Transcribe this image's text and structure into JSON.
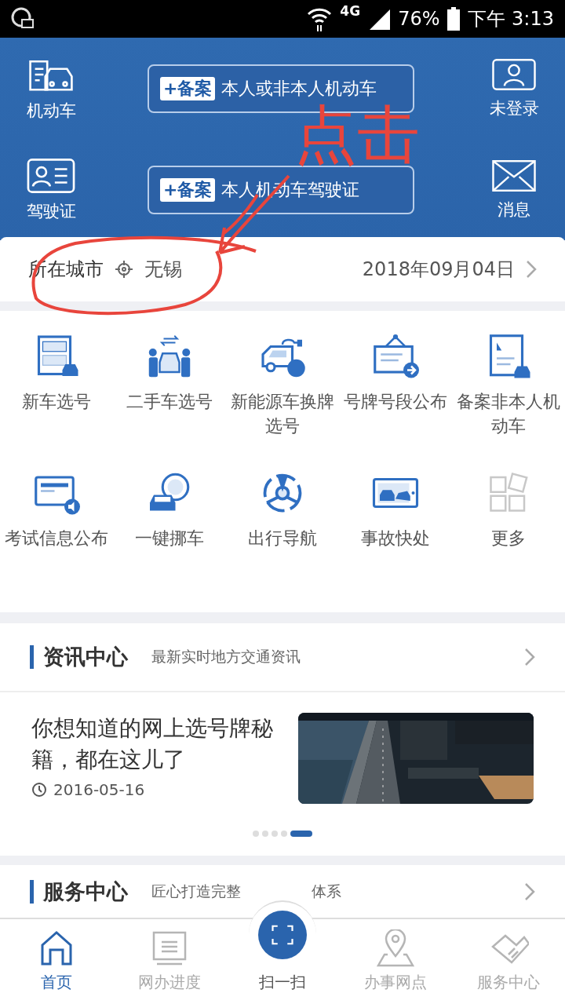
{
  "status_bar": {
    "network": "4G",
    "battery": "76%",
    "time": "下午 3:13"
  },
  "header": {
    "left": [
      {
        "kind": "car",
        "label": "机动车"
      },
      {
        "kind": "license",
        "label": "驾驶证"
      }
    ],
    "cards": [
      {
        "badge": "+备案",
        "text": "本人或非本人机动车"
      },
      {
        "badge": "+备案",
        "text": "本人机动车驾驶证"
      }
    ],
    "right": [
      {
        "kind": "user",
        "label": "未登录"
      },
      {
        "kind": "mail",
        "label": "消息"
      }
    ]
  },
  "city_bar": {
    "label": "所在城市",
    "city": "无锡",
    "date": "2018年09月04日"
  },
  "services": [
    {
      "kind": "plate",
      "label": "新车选号"
    },
    {
      "kind": "trade",
      "label": "二手车选号"
    },
    {
      "kind": "ev",
      "label": "新能源车换牌选号"
    },
    {
      "kind": "notice",
      "label": "号牌号段公布"
    },
    {
      "kind": "record",
      "label": "备案非本人机动车"
    },
    {
      "kind": "exam",
      "label": "考试信息公布"
    },
    {
      "kind": "move",
      "label": "一键挪车"
    },
    {
      "kind": "nav",
      "label": "出行导航"
    },
    {
      "kind": "accident",
      "label": "事故快处"
    },
    {
      "kind": "more",
      "label": "更多"
    }
  ],
  "news": {
    "title": "资讯中心",
    "subtitle": "最新实时地方交通资讯",
    "article": {
      "title": "你想知道的网上选号牌秘籍，都在这儿了",
      "date": "2016-05-16"
    },
    "dots": [
      {
        "selected": false
      },
      {
        "selected": false
      },
      {
        "selected": false
      },
      {
        "selected": false
      },
      {
        "selected": true
      }
    ]
  },
  "service_center": {
    "title": "服务中心",
    "subtitle_parts": [
      "匠心打造完整",
      "体系"
    ]
  },
  "tab_bar": [
    {
      "kind": "home",
      "label": "首页",
      "selected": true
    },
    {
      "kind": "progress",
      "label": "网办进度",
      "selected": false
    },
    {
      "kind": "scan",
      "label": "扫一扫",
      "selected": false
    },
    {
      "kind": "pin",
      "label": "办事网点",
      "selected": false
    },
    {
      "kind": "hands",
      "label": "服务中心",
      "selected": false
    }
  ],
  "annotation": {
    "text": "点击"
  }
}
